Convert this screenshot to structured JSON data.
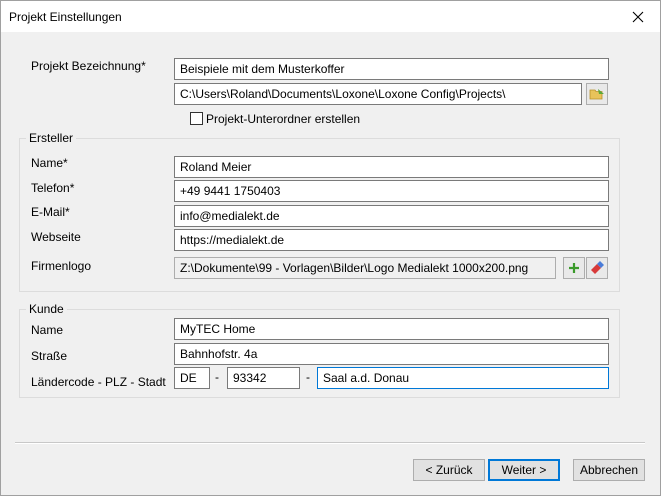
{
  "window": {
    "title": "Projekt Einstellungen"
  },
  "project": {
    "name_label": "Projekt Bezeichnung*",
    "name_value": "Beispiele mit dem Musterkoffer",
    "path_value": "C:\\Users\\Roland\\Documents\\Loxone\\Loxone Config\\Projects\\",
    "subfolder_label": "Projekt-Unterordner erstellen"
  },
  "creator": {
    "group_label": "Ersteller",
    "name_label": "Name*",
    "name_value": "Roland Meier",
    "phone_label": "Telefon*",
    "phone_value": "+49 9441 1750403",
    "email_label": "E-Mail*",
    "email_value": "info@medialekt.de",
    "website_label": "Webseite",
    "website_value": "https://medialekt.de",
    "logo_label": "Firmenlogo",
    "logo_value": "Z:\\Dokumente\\99 - Vorlagen\\Bilder\\Logo Medialekt 1000x200.png"
  },
  "customer": {
    "group_label": "Kunde",
    "name_label": "Name",
    "name_value": "MyTEC Home",
    "street_label": "Straße",
    "street_value": "Bahnhofstr. 4a",
    "location_label": "Ländercode - PLZ - Stadt",
    "country_value": "DE",
    "zip_value": "93342",
    "city_value": "Saal a.d. Donau",
    "dash": "-"
  },
  "buttons": {
    "back": "< Zurück",
    "next": "Weiter >",
    "cancel": "Abbrechen"
  },
  "icons": {
    "folder": "folder-browse-icon",
    "add": "add-icon",
    "eraser": "eraser-icon",
    "close": "close-icon"
  }
}
